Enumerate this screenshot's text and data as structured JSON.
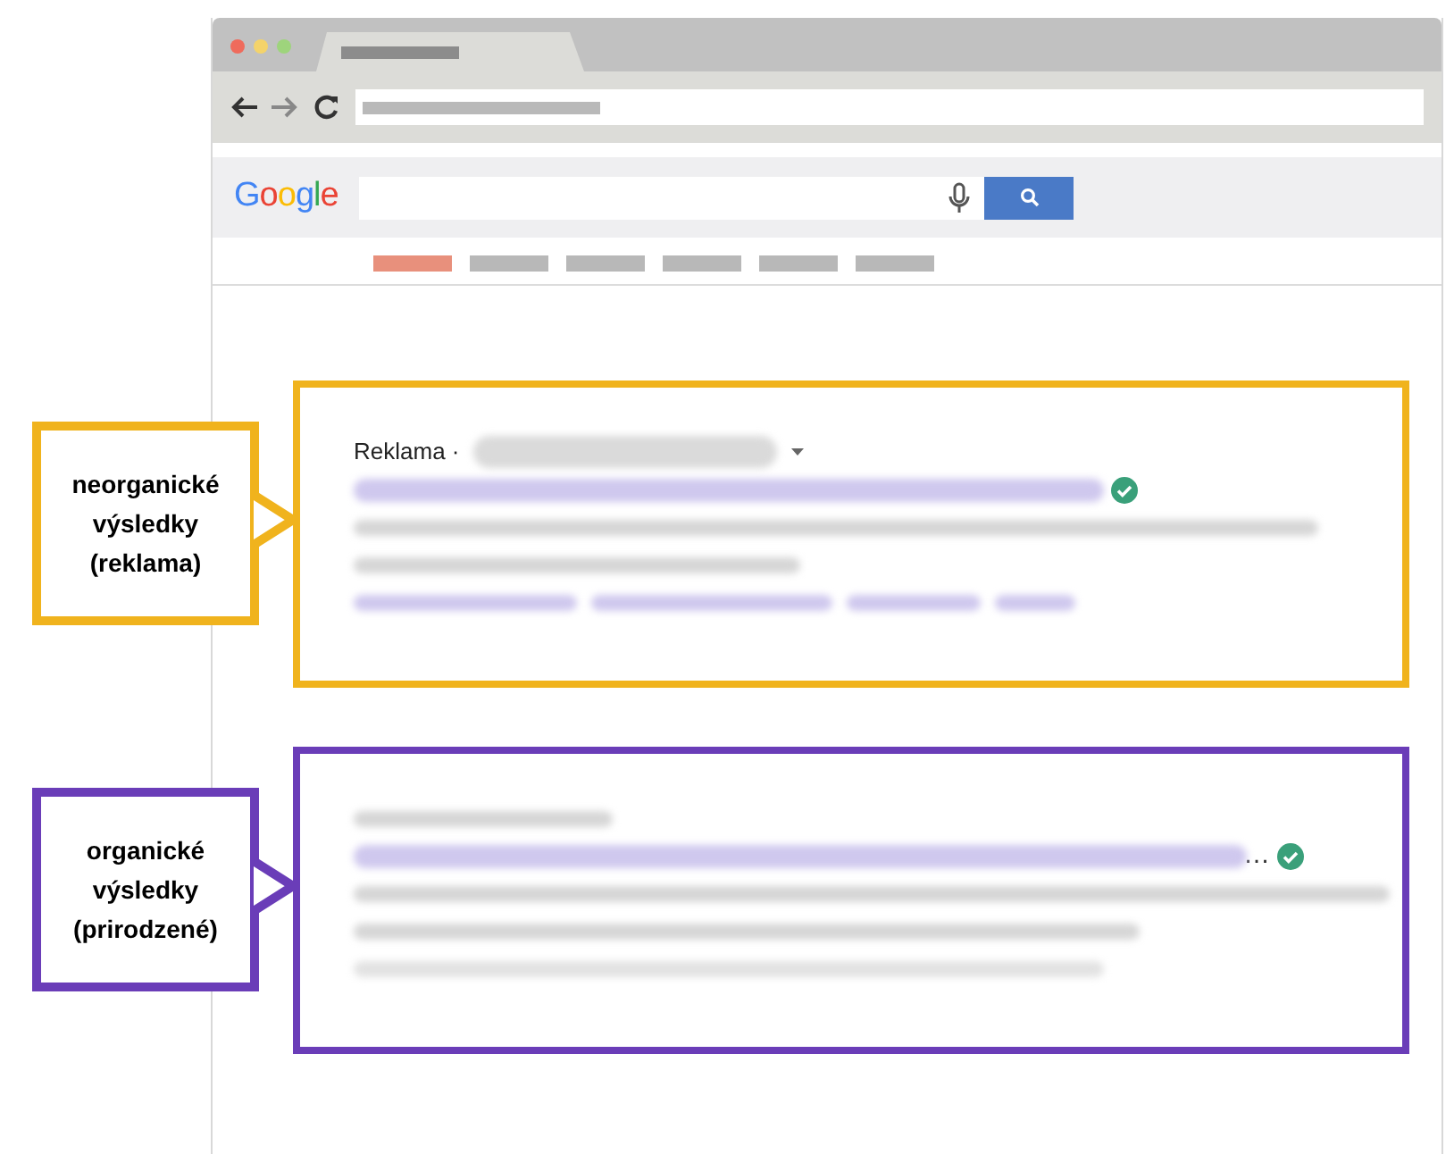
{
  "logo": "Google",
  "nav_tabs": [
    {
      "selected": true
    },
    {
      "selected": false
    },
    {
      "selected": false
    },
    {
      "selected": false
    },
    {
      "selected": false
    },
    {
      "selected": false
    }
  ],
  "results": [
    {
      "kind": "ad",
      "label": "Reklama ·",
      "verified": true,
      "color": "#f0b31d",
      "annotation": "neorganické výsledky (reklama)"
    },
    {
      "kind": "organic",
      "ellipsis": "…",
      "verified": true,
      "color": "#6a3db8",
      "annotation": "organické výsledky (prirodzené)"
    }
  ]
}
